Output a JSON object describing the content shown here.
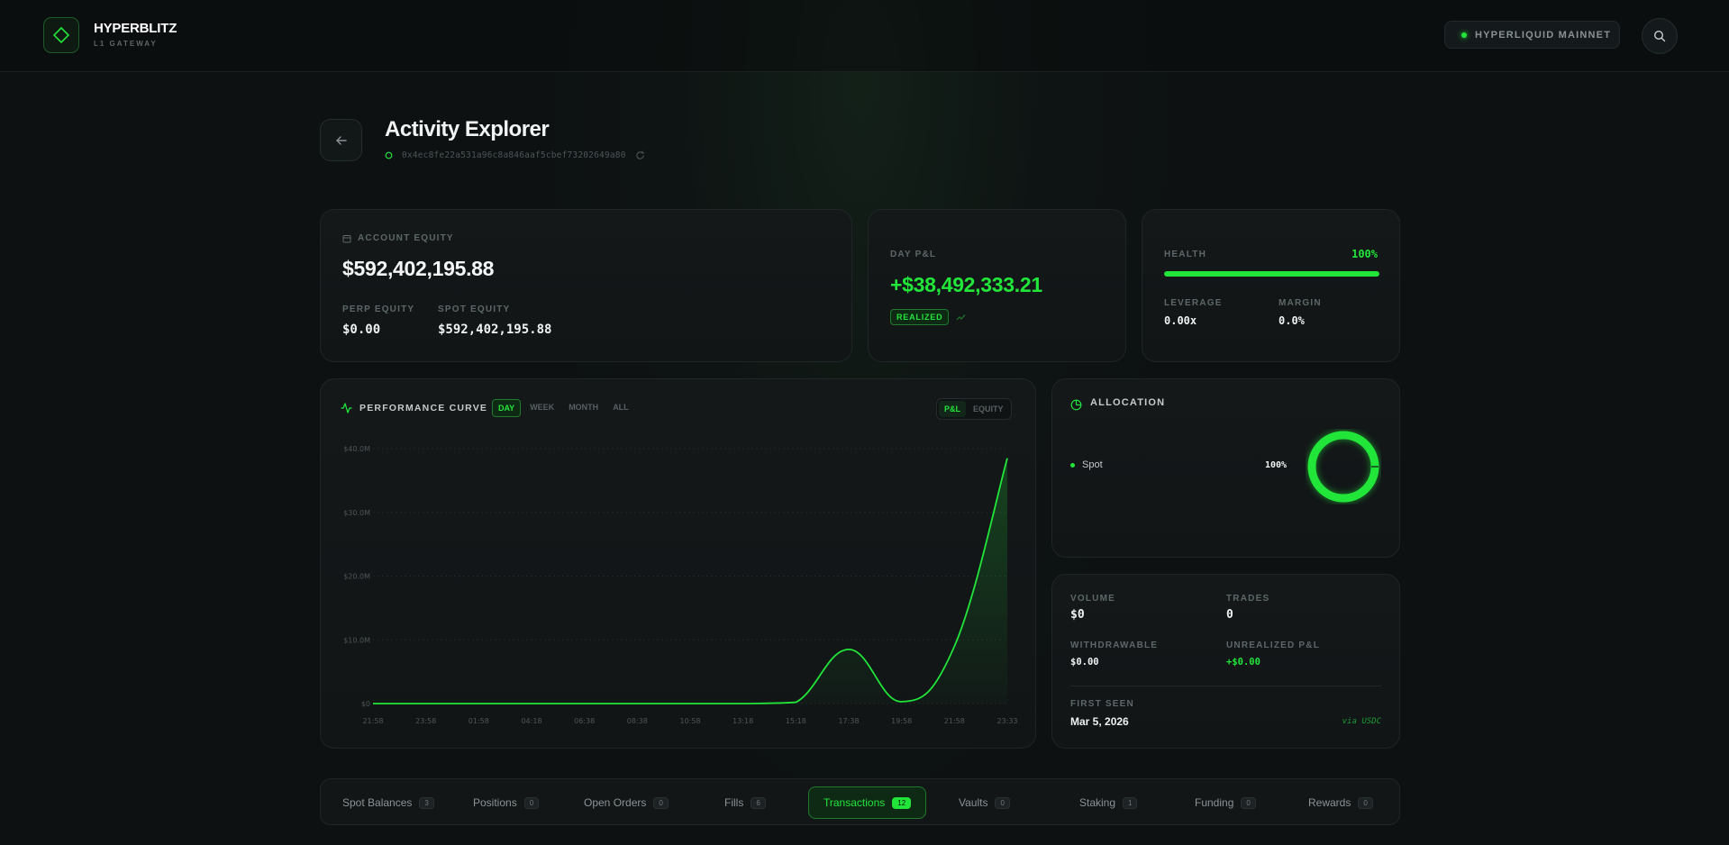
{
  "brand": {
    "name": "HYPERBLITZ",
    "subtitle": "L1 GATEWAY"
  },
  "network": {
    "label": "HYPERLIQUID MAINNET"
  },
  "header": {
    "title": "Activity Explorer",
    "address": "0x4ec8fe22a531a96c8a846aaf5cbef73202649a80"
  },
  "equity": {
    "label": "ACCOUNT EQUITY",
    "value": "$592,402,195.88",
    "perp_label": "PERP EQUITY",
    "perp_value": "$0.00",
    "spot_label": "SPOT EQUITY",
    "spot_value": "$592,402,195.88"
  },
  "day_pnl": {
    "label": "DAY P&L",
    "value": "+$38,492,333.21",
    "badge": "REALIZED"
  },
  "health": {
    "label": "HEALTH",
    "percent_label": "100%",
    "level": 1.0,
    "leverage_label": "LEVERAGE",
    "leverage_value": "0.00x",
    "margin_label": "MARGIN",
    "margin_value": "0.0%"
  },
  "performance": {
    "title": "PERFORMANCE CURVE",
    "time_tabs": [
      "DAY",
      "WEEK",
      "MONTH",
      "ALL"
    ],
    "active_time_tab": "DAY",
    "mode_tabs": [
      "P&L",
      "EQUITY"
    ],
    "active_mode_tab": "P&L"
  },
  "chart_data": {
    "type": "line",
    "x": [
      "21:58",
      "23:58",
      "01:58",
      "04:18",
      "06:38",
      "08:38",
      "10:58",
      "13:18",
      "15:18",
      "17:38",
      "19:58",
      "21:58",
      "23:33"
    ],
    "y_ticks": [
      "$0",
      "$10.0M",
      "$20.0M",
      "$30.0M",
      "$40.0M"
    ],
    "ylim": [
      0,
      40000000
    ],
    "series": [
      {
        "values": [
          0,
          0,
          0,
          0,
          0,
          0,
          0,
          0,
          200000,
          8500000,
          300000,
          9000000,
          38500000
        ]
      }
    ],
    "grid": true,
    "color": "#22e53a"
  },
  "allocation": {
    "title": "ALLOCATION",
    "items": [
      {
        "name": "Spot",
        "percent": "100%"
      }
    ]
  },
  "stats": {
    "volume_label": "VOLUME",
    "volume_value": "$0",
    "trades_label": "TRADES",
    "trades_value": "0",
    "withdrawable_label": "WITHDRAWABLE",
    "withdrawable_value": "$0.00",
    "unrealized_label": "UNREALIZED P&L",
    "unrealized_value": "+$0.00",
    "first_seen_label": "FIRST SEEN",
    "first_seen_value": "Mar 5, 2026",
    "first_seen_via": "via USDC"
  },
  "tabs": [
    {
      "label": "Spot Balances",
      "count": "3"
    },
    {
      "label": "Positions",
      "count": "0"
    },
    {
      "label": "Open Orders",
      "count": "0"
    },
    {
      "label": "Fills",
      "count": "6"
    },
    {
      "label": "Transactions",
      "count": "12"
    },
    {
      "label": "Vaults",
      "count": "0"
    },
    {
      "label": "Staking",
      "count": "1"
    },
    {
      "label": "Funding",
      "count": "0"
    },
    {
      "label": "Rewards",
      "count": "0"
    }
  ],
  "active_tab": "Transactions",
  "colors": {
    "accent": "#22e53a",
    "background": "#0d1112",
    "card": "#141819"
  }
}
